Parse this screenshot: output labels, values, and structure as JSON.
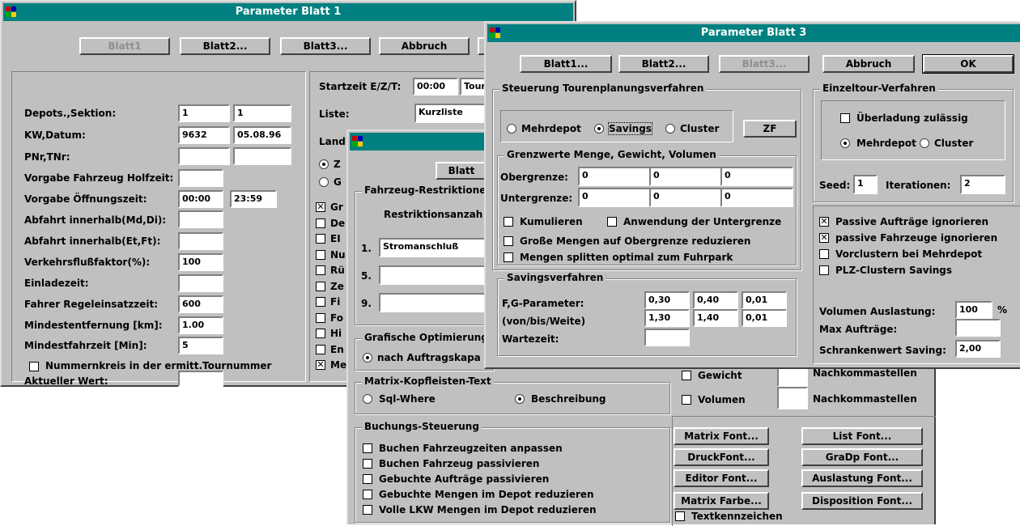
{
  "w1": {
    "title": "Parameter Blatt 1",
    "buttons": [
      "Blatt1",
      "Blatt2...",
      "Blatt3...",
      "Abbruch"
    ],
    "labels": [
      "Depots.,Sektion:",
      "KW,Datum:",
      "PNr,TNr:",
      "Vorgabe Fahrzeug Holfzeit:",
      "Vorgabe Öffnungszeit:",
      "Abfahrt innerhalb(Md,Di):",
      "Abfahrt innerhalb(Et,Ft):",
      "Verkehrsflußfaktor(%):",
      "Einladezeit:",
      "Fahrer Regeleinsatzzeit:",
      "Mindestentfernung [km]:",
      "Mindestfahrzeit [Min]:"
    ],
    "fields": {
      "depot": "1",
      "sektion": "1",
      "kw": "9632",
      "datum": "05.08.96",
      "oeffnung_von": "00:00",
      "oeffnung_bis": "23:59",
      "verkehr": "100",
      "fahrer": "600",
      "entfernung": "1.00",
      "fahrzeit": "5"
    },
    "nummernkreis": "Nummernkreis in der ermitt.Tournummer",
    "aktueller": "Aktueller Wert:",
    "startzeit_label": "Startzeit E/Z/T:",
    "startzeit_val": "00:00",
    "tour_val": "Tour",
    "liste_label": "Liste:",
    "liste_val": "Kurzliste",
    "land_label": "Land",
    "radio_frag": [
      "Z",
      "G"
    ],
    "check_frag": [
      "Gr",
      "De",
      "EI",
      "Nu",
      "Rü",
      "Ze",
      "Fi",
      "Fo",
      "Hi",
      "En",
      "Me"
    ]
  },
  "w2": {
    "blatt": "Blatt",
    "restr_group": "Fahrzeug-Restriktionen",
    "restr_label": "Restriktionsanzah",
    "rows": [
      "1.",
      "5.",
      "9."
    ],
    "row1_val": "Stromanschluß",
    "opt_group": "Grafische Optimierung",
    "opt_radio": "nach Auftragskapa",
    "matrix_group": "Matrix-Kopfleisten-Text",
    "sqlwhere": "Sql-Where",
    "beschreibung": "Beschreibung",
    "gewicht": "Gewicht",
    "volumen": "Volumen",
    "nachkomma": "Nachkommastellen",
    "buchung_group": "Buchungs-Steuerung",
    "buchung": [
      "Buchen Fahrzeugzeiten anpassen",
      "Buchen Fahrzeug passivieren",
      "Gebuchte Aufträge passivieren",
      "Gebuchte Mengen im Depot reduzieren",
      "Volle LKW Mengen im Depot reduzieren"
    ],
    "font_buttons": [
      "Matrix Font...",
      "List Font...",
      "DruckFont...",
      "GraDp Font...",
      "Editor Font...",
      "Auslastung Font...",
      "Matrix Farbe...",
      "Disposition Font..."
    ],
    "textkenn": "Textkennzeichen"
  },
  "w3": {
    "title": "Parameter  Blatt 3",
    "buttons": [
      "Blatt1...",
      "Blatt2...",
      "Blatt3...",
      "Abbruch",
      "OK"
    ],
    "steuer_group": "Steuerung Tourenplanungsverfahren",
    "radios": [
      "Mehrdepot",
      "Savings",
      "Cluster"
    ],
    "zf": "ZF",
    "grenz_group": "Grenzwerte Menge, Gewicht, Volumen",
    "ober": "Obergrenze:",
    "unter": "Untergrenze:",
    "zero": "0",
    "kumulieren": "Kumulieren",
    "anwendung": "Anwendung der Untergrenze",
    "grosse": "Große Mengen auf Obergrenze reduzieren",
    "splitten": "Mengen splitten optimal zum Fuhrpark",
    "sav_group": "Savingsverfahren",
    "fg": "F,G-Parameter:",
    "vbw": "(von/bis/Weite)",
    "warte": "Wartezeit:",
    "fg_vals": [
      "0,30",
      "0,40",
      "0,01",
      "1,30",
      "1,40",
      "0,01"
    ],
    "einz_group": "Einzeltour-Verfahren",
    "ueberl": "Überladung zulässig",
    "einz_radios": [
      "Mehrdepot",
      "Cluster"
    ],
    "seed": "Seed:",
    "seed_val": "1",
    "iter": "Iterationen:",
    "iter_val": "2",
    "checks": [
      "Passive Aufträge ignorieren",
      "passive Fahrzeuge ignorieren",
      "Vorclustern bei Mehrdepot",
      "PLZ-Clustern Savings"
    ],
    "vol_ausl": "Volumen Auslastung:",
    "vol_val": "100",
    "pct": "%",
    "max_auf": "Max Aufträge:",
    "schranke": "Schrankenwert Saving:",
    "schranke_val": "2,00"
  }
}
